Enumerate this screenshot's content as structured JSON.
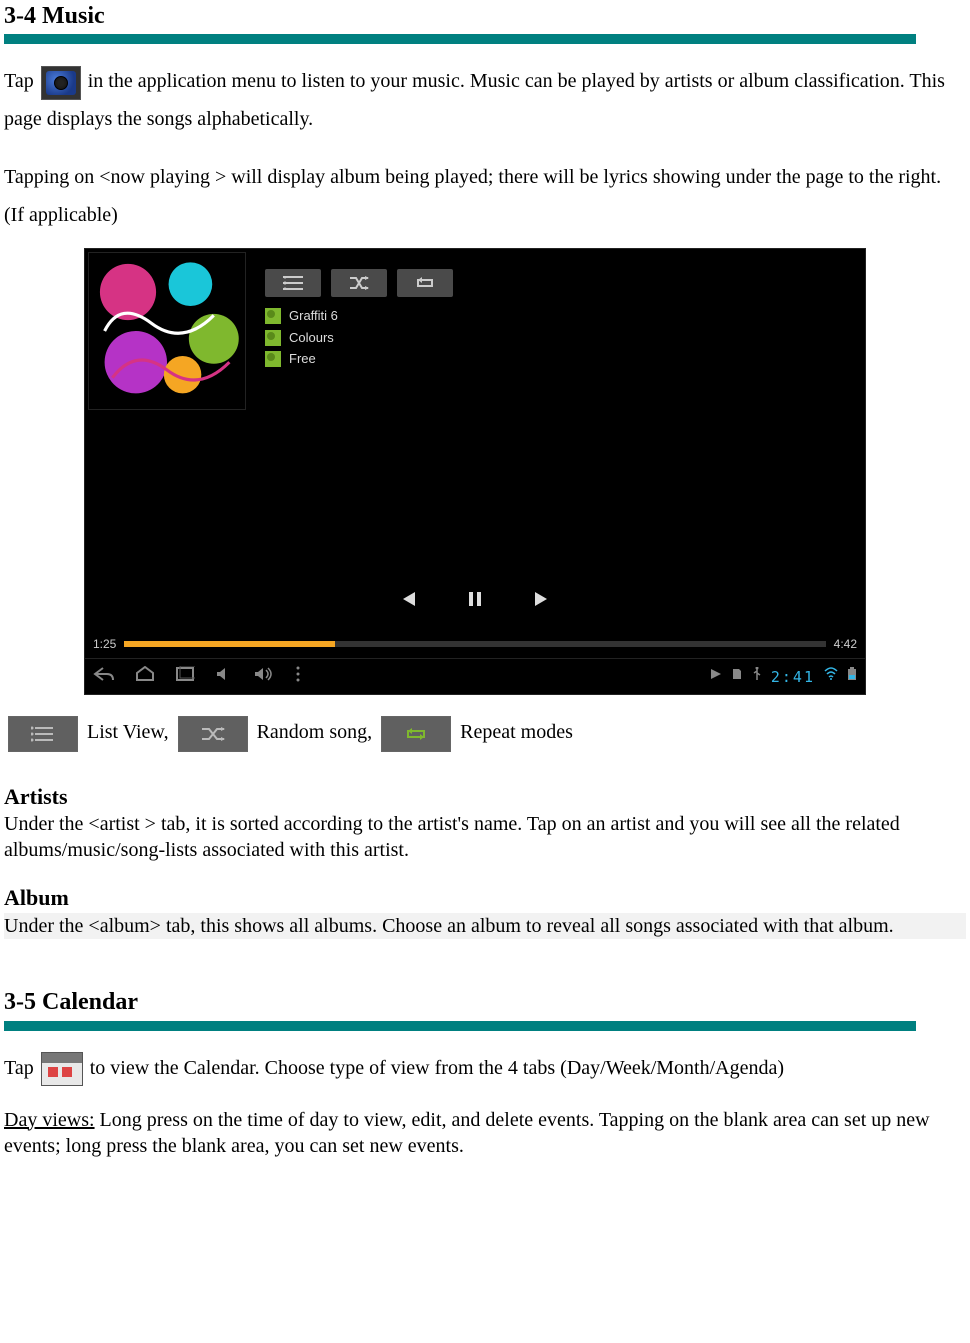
{
  "section1": {
    "heading": "3-4 Music",
    "para1_a": "Tap ",
    "para1_b": " in the application menu to listen to your music. Music can be played by artists or album classification. This page displays the songs alphabetically.",
    "para2": "Tapping on <now playing > will display album being played; there will be lyrics showing under the page to the right. (If applicable)"
  },
  "player": {
    "artist": "Graffiti 6",
    "album": "Colours",
    "track": "Free",
    "time_current": "1:25",
    "time_total": "4:42",
    "clock": "2:41"
  },
  "legend": {
    "list": " List View, ",
    "random": " Random song, ",
    "repeat": " Repeat modes"
  },
  "artists": {
    "heading": "Artists",
    "text": "Under the <artist > tab, it is sorted according to the artist's name. Tap on an artist and you will see all the related albums/music/song-lists associated with this artist."
  },
  "album": {
    "heading": "Album",
    "text": "Under the <album> tab, this shows all albums.   Choose an album to reveal all songs associated with that album."
  },
  "section2": {
    "heading": "3-5 Calendar",
    "para1_a": "Tap ",
    "para1_b": " to view the Calendar.   Choose type of view from the 4 tabs (Day/Week/Month/Agenda)",
    "dayviews_label": "Day views:",
    "dayviews_text": " Long press on the time of day to view, edit, and delete events.   Tapping on the blank area can set up new events; long press the blank area, you can set new events."
  }
}
